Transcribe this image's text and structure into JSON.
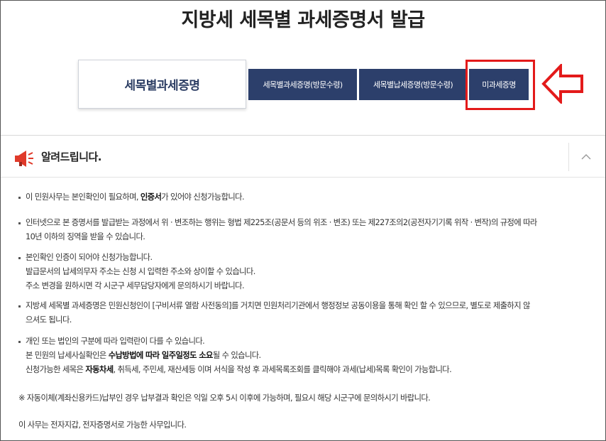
{
  "page": {
    "title": "지방세 세목별 과세증명서 발급"
  },
  "tabs": {
    "current_label": "세목별과세증명",
    "items": [
      {
        "label": "세목별과세증명(방문수령)"
      },
      {
        "label": "세목별납세증명(방문수령)"
      },
      {
        "label": "미과세증명"
      }
    ]
  },
  "annotation": {
    "highlight_color": "#e31a1a",
    "arrow_icon": "left-arrow-icon"
  },
  "colors": {
    "tab_bg": "#2c3f6b",
    "current_tab_text": "#2d3e64"
  },
  "notice": {
    "title": "알려드립니다.",
    "icon": "megaphone-icon",
    "collapse_icon": "chevron-up-icon",
    "item1": {
      "pre": "이 민원사무는 본인확인이 필요하며, ",
      "bold": "인증서",
      "post": "가 있어야 신청가능합니다."
    },
    "item2": {
      "line1": "인터넷으로 본 증명서를 발급받는 과정에서 위 · 변조하는 행위는 형법 제225조(공문서 등의 위조 · 변조) 또는 제227조의2(공전자기기록 위작 · 변작)의 규정에 따라",
      "line2": "10년 이하의 징역을 받을 수 있습니다."
    },
    "item3": {
      "line1": "본인확인 인증이 되어야 신청가능합니다.",
      "line2": "발급문서의 납세의무자 주소는 신청 시 입력한 주소와 상이할 수 있습니다.",
      "line3": "주소 변경을 원하시면 각 시군구 세무담당자에게 문의하시기 바랍니다."
    },
    "item4": {
      "line1": "지방세 세목별 과세증명은 민원신청인이 [구비서류 열람 사전동의]를 거치면 민원처리기관에서 행정정보 공동이용을 통해 확인 할 수 있으므로, 별도로 제출하지 않",
      "line2": "으셔도 됩니다."
    },
    "item5": {
      "line1": "개인 또는 법인의 구분에 따라 입력란이 다를 수 있습니다.",
      "line2_pre": "본 민원의 납세사실확인은 ",
      "line2_bold": "수납방법에 따라 일주일정도 소요",
      "line2_post": "될 수 있습니다.",
      "line3_pre": "신청가능한 세목은 ",
      "line3_bold": "자동차세",
      "line3_post": ", 취득세, 주민세, 재산세등 이며 서식을 작성 후 과세목록조회를 클릭해야 과세(납세)목록 확인이 가능합니다."
    },
    "footnote": "※ 자동이체(계좌신용카드)납부인 경우 납부결과 확인은 익일 오후 5시 이후에 가능하며, 필요시 해당 시군구에 문의하시기 바랍니다.",
    "last": "이 사무는 전자지갑, 전자증명서로 가능한 사무입니다."
  }
}
